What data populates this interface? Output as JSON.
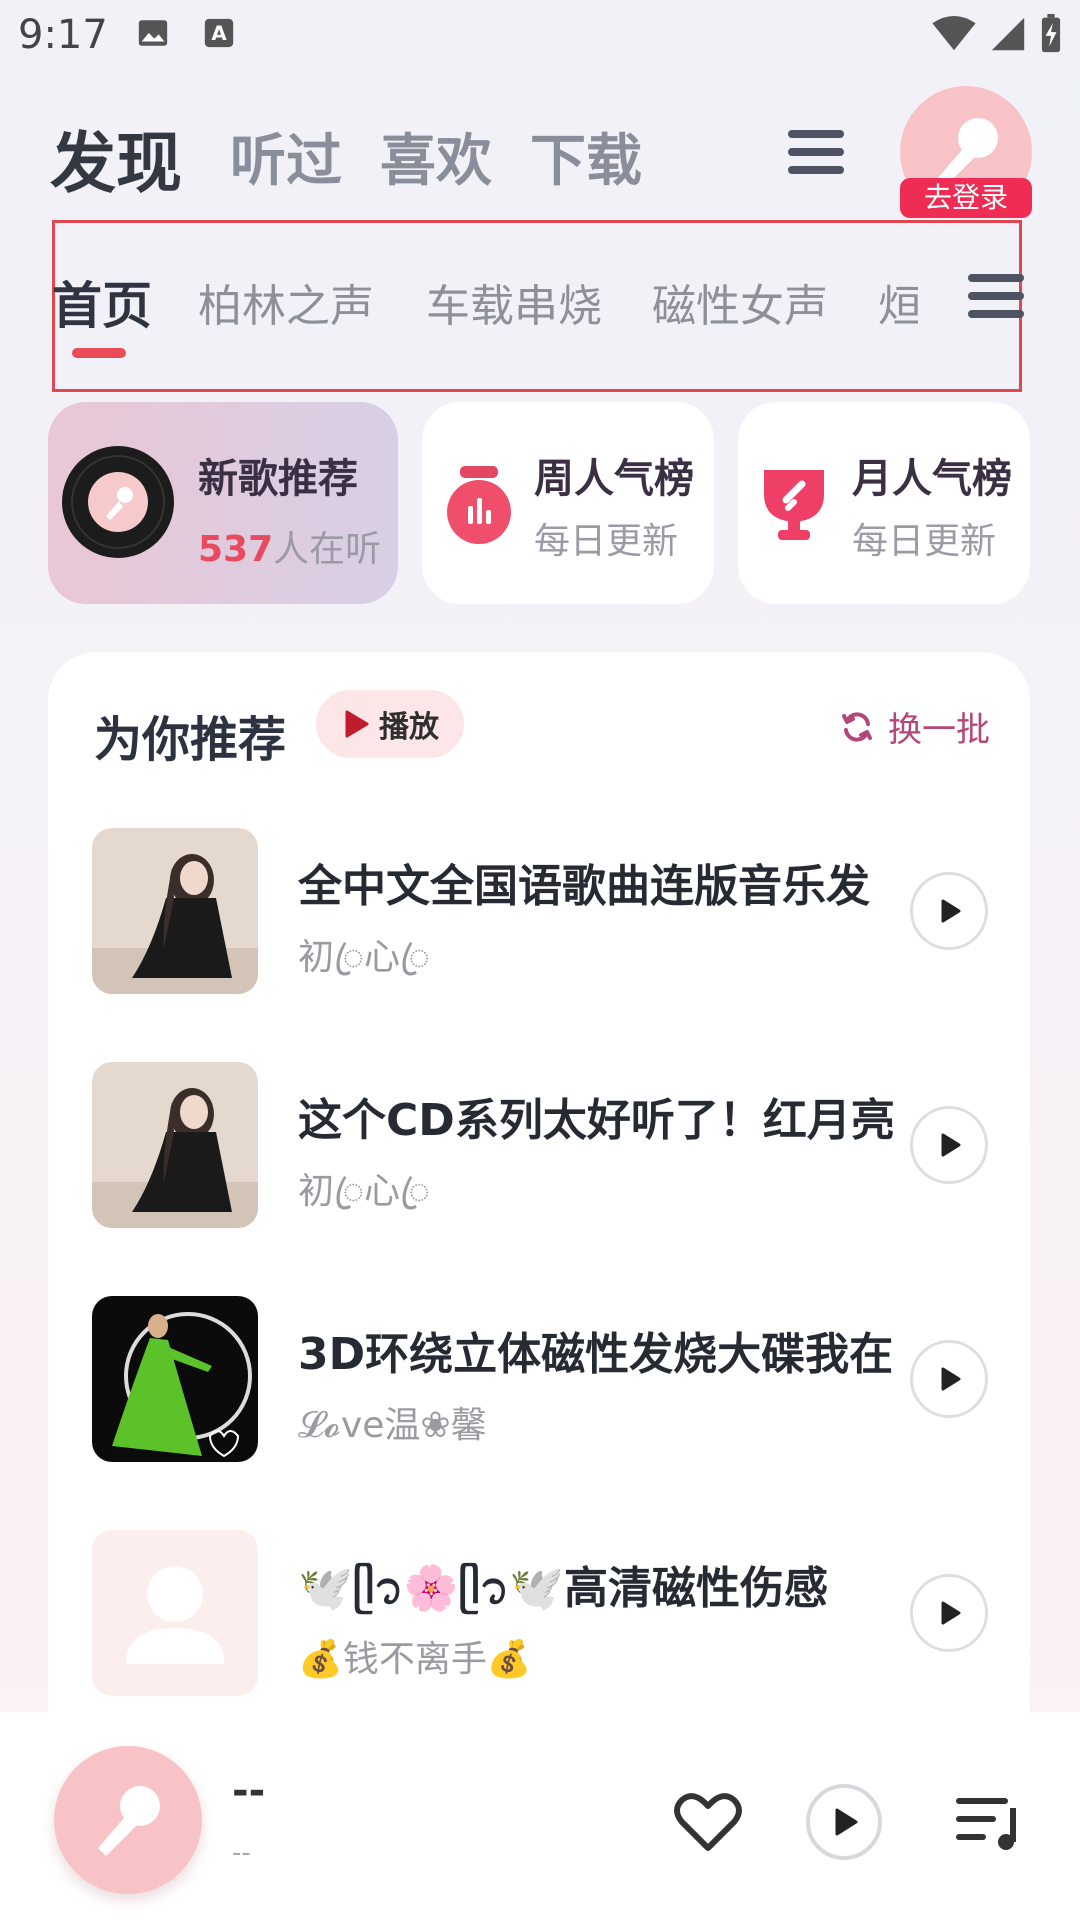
{
  "status_bar": {
    "time": "9:17",
    "icons": [
      "gallery-icon",
      "keyboard-a-icon",
      "wifi-icon",
      "signal-icon",
      "battery-charging-icon"
    ]
  },
  "header": {
    "tabs": [
      {
        "label": "发现",
        "active": true
      },
      {
        "label": "听过",
        "active": false
      },
      {
        "label": "喜欢",
        "active": false
      },
      {
        "label": "下载",
        "active": false
      }
    ],
    "login_badge": "去登录"
  },
  "categories": [
    {
      "label": "首页",
      "active": true
    },
    {
      "label": "柏林之声",
      "active": false
    },
    {
      "label": "车载串烧",
      "active": false
    },
    {
      "label": "磁性女声",
      "active": false
    },
    {
      "label": "烜",
      "active": false
    }
  ],
  "quick_cards": [
    {
      "title": "新歌推荐",
      "count": "537",
      "count_suffix": "人在听"
    },
    {
      "title": "周人气榜",
      "sub": "每日更新"
    },
    {
      "title": "月人气榜",
      "sub": "每日更新"
    }
  ],
  "recommend": {
    "title": "为你推荐",
    "play_label": "播放",
    "refresh_label": "换一批",
    "songs": [
      {
        "title": "全中文全国语歌曲连版音乐发",
        "artist": "初ꦿ心ꦿ"
      },
      {
        "title": "这个CD系列太好听了！红月亮",
        "artist": "初ꦿ心ꦿ"
      },
      {
        "title": "3D环绕立体磁性发烧大碟我在",
        "artist": "𝓛𝓸ve温❀馨"
      },
      {
        "title": "🕊️ᥫ᭡🌸ᥫ᭡🕊️高清磁性伤感",
        "artist": "💰钱不离手💰"
      }
    ]
  },
  "player": {
    "title": "--",
    "subtitle": "--"
  },
  "colors": {
    "accent": "#e94b57",
    "login_badge": "#ef2d54",
    "refresh": "#b3477a",
    "count": "#e84a5f"
  }
}
